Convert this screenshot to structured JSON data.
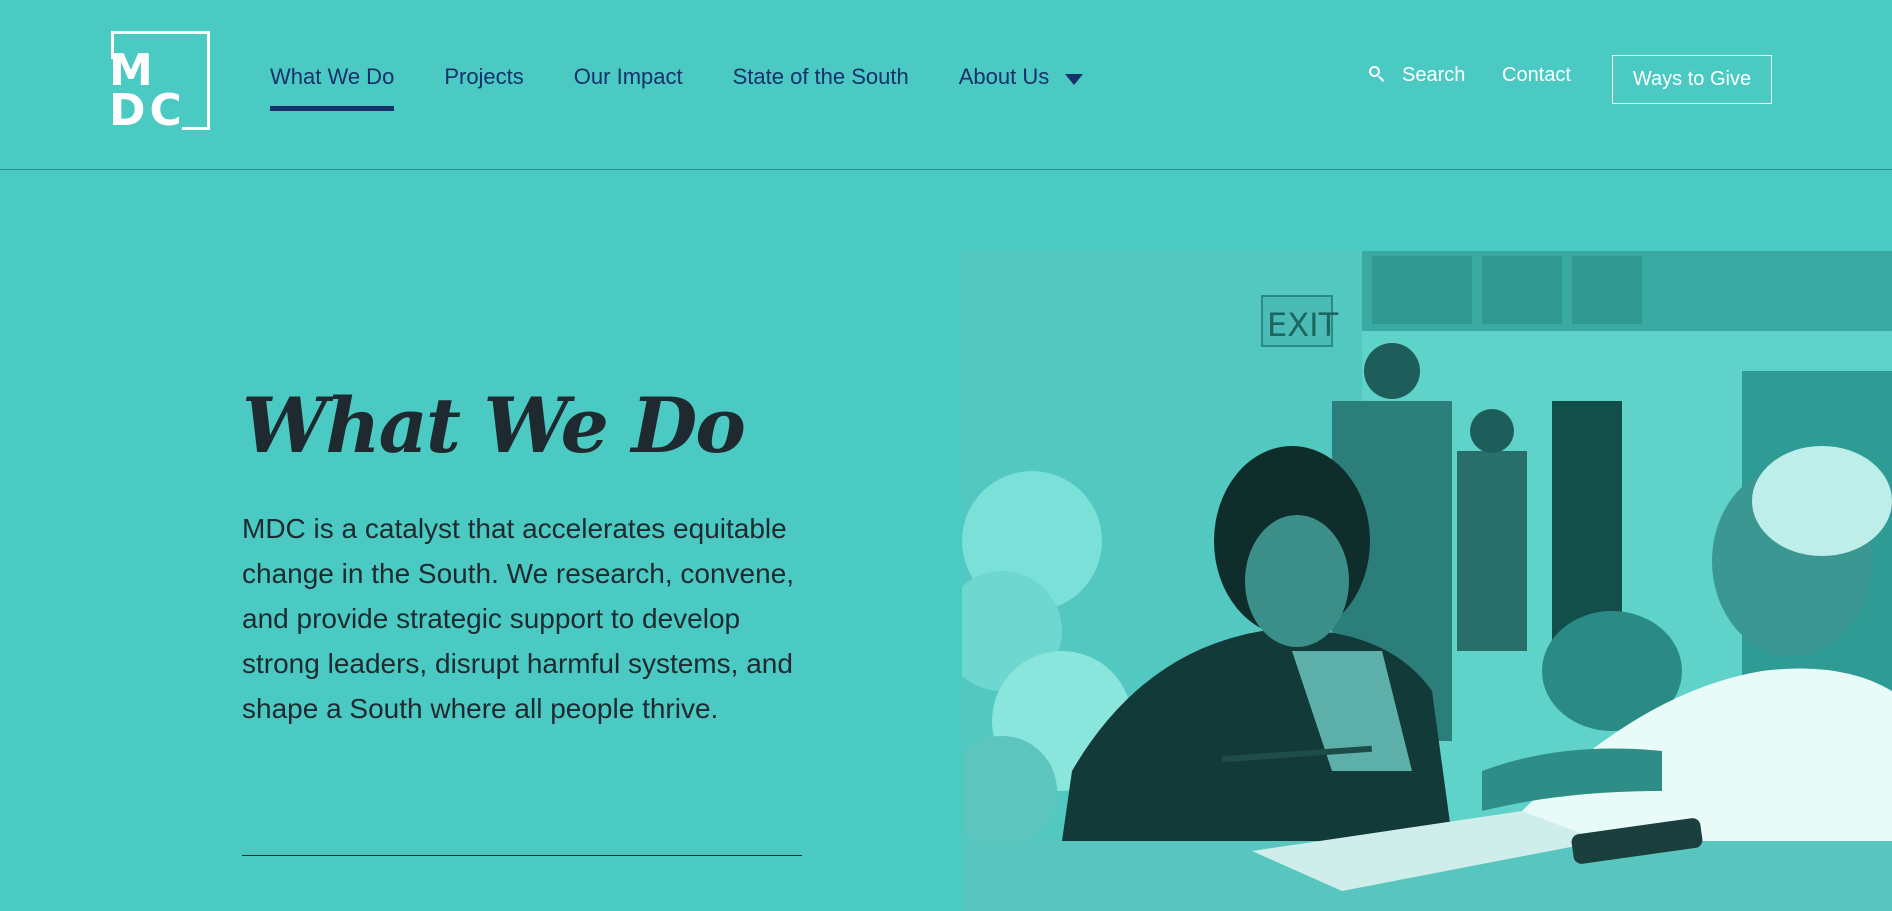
{
  "logo": {
    "line1": "M",
    "line2": "DC"
  },
  "nav": [
    {
      "label": "What We Do",
      "active": true
    },
    {
      "label": "Projects",
      "active": false
    },
    {
      "label": "Our Impact",
      "active": false
    },
    {
      "label": "State of the South",
      "active": false
    },
    {
      "label": "About Us",
      "active": false,
      "has_dropdown": true
    }
  ],
  "utility": {
    "search_label": "Search",
    "contact_label": "Contact",
    "give_label": "Ways to Give"
  },
  "hero": {
    "title": "What We Do",
    "body": "MDC is a catalyst that accelerates equitable change in the South. We research, convene, and provide strategic support to develop strong leaders, disrupt harmful systems, and shape a South where all people thrive.",
    "photo_sign_text": "EXIT"
  },
  "colors": {
    "background": "#4acac2",
    "nav_text": "#15306b",
    "body_text": "#1f2a30",
    "white": "#ffffff"
  },
  "icons": [
    "search-icon",
    "chevron-down-icon"
  ]
}
